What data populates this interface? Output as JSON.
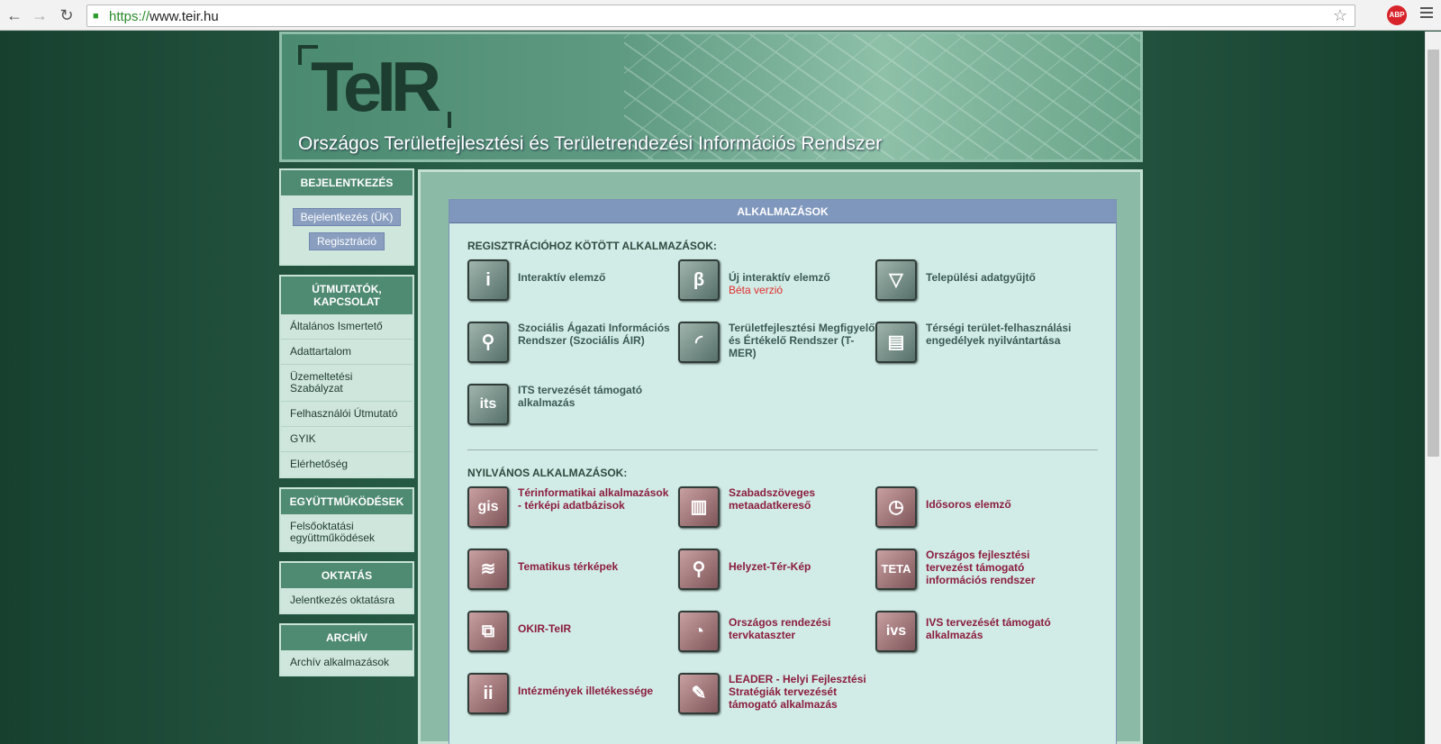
{
  "browser": {
    "url_proto": "https://",
    "url_host": "www.teir.hu",
    "abp_label": "ABP"
  },
  "banner": {
    "logo_text": "TeIR",
    "title": "Országos Területfejlesztési és Területrendezési Információs Rendszer"
  },
  "sidebar": {
    "login": {
      "title": "BEJELENTKEZÉS",
      "login_button": "Bejelentkezés (ÜK)",
      "register_button": "Regisztráció"
    },
    "guides": {
      "title": "ÚTMUTATÓK, KAPCSOLAT",
      "items": [
        "Általános Ismertető",
        "Adattartalom",
        "Üzemeltetési Szabályzat",
        "Felhasználói Útmutató",
        "GYIK",
        "Elérhetőség"
      ]
    },
    "cooperation": {
      "title": "EGYÜTTMŰKÖDÉSEK",
      "items": [
        "Felsőoktatási együttműködések"
      ]
    },
    "education": {
      "title": "OKTATÁS",
      "items": [
        "Jelentkezés oktatásra"
      ]
    },
    "archive": {
      "title": "ARCHÍV",
      "items": [
        "Archív alkalmazások"
      ]
    }
  },
  "main": {
    "header": "ALKALMAZÁSOK",
    "registered_title": "REGISZTRÁCIÓHOZ KÖTÖTT ALKALMAZÁSOK:",
    "registered_apps": [
      {
        "label": "Interaktív elemző",
        "icon": "info-icon",
        "glyph": "i"
      },
      {
        "label": "Új interaktív elemző",
        "note": "Béta verzió",
        "icon": "beta-icon",
        "glyph": "β"
      },
      {
        "label": "Települési adatgyűjtő",
        "icon": "funnel-icon",
        "glyph": "▽"
      },
      {
        "label": " Szociális Ágazati Információs Rendszer (Szociális ÁIR)",
        "icon": "people-icon",
        "glyph": "⚲"
      },
      {
        "label": "Területfejlesztési Megfigyelő és Értékelő Rendszer (T-MER)",
        "icon": "curve-icon",
        "glyph": "◜"
      },
      {
        "label": "Térségi terület-felhasználási engedélyek nyilvántartása",
        "icon": "documents-icon",
        "glyph": "▤"
      },
      {
        "label": "ITS tervezését támogató alkalmazás",
        "icon": "its-icon",
        "glyph": "its"
      }
    ],
    "public_title": "NYILVÁNOS ALKALMAZÁSOK:",
    "public_apps": [
      {
        "label": "Térinformatikai alkalmazások - térképi adatbázisok",
        "icon": "gis-icon",
        "glyph": "gis"
      },
      {
        "label": "Szabadszöveges metaadatkereső",
        "icon": "book-icon",
        "glyph": "▥"
      },
      {
        "label": "Idősoros elemző",
        "icon": "clock-icon",
        "glyph": "◷"
      },
      {
        "label": "Tematikus térképek",
        "icon": "layers-icon",
        "glyph": "≋"
      },
      {
        "label": "Helyzet-Tér-Kép",
        "icon": "magnifier-icon",
        "glyph": "⚲"
      },
      {
        "label": "Országos fejlesztési tervezést támogató információs rendszer",
        "icon": "teta-icon",
        "glyph": "TETA"
      },
      {
        "label": "OKIR-TeIR",
        "icon": "okir-icon",
        "glyph": "⧉"
      },
      {
        "label": "Országos rendezési tervkataszter",
        "icon": "disk-icon",
        "glyph": "◔"
      },
      {
        "label": "IVS tervezését támogató alkalmazás",
        "icon": "ivs-icon",
        "glyph": "ivs"
      },
      {
        "label": "Intézmények illetékessége",
        "icon": "ii-icon",
        "glyph": "ii"
      },
      {
        "label": "LEADER - Helyi Fejlesztési Stratégiák tervezését támogató alkalmazás",
        "icon": "leader-icon",
        "glyph": "✎"
      }
    ]
  }
}
